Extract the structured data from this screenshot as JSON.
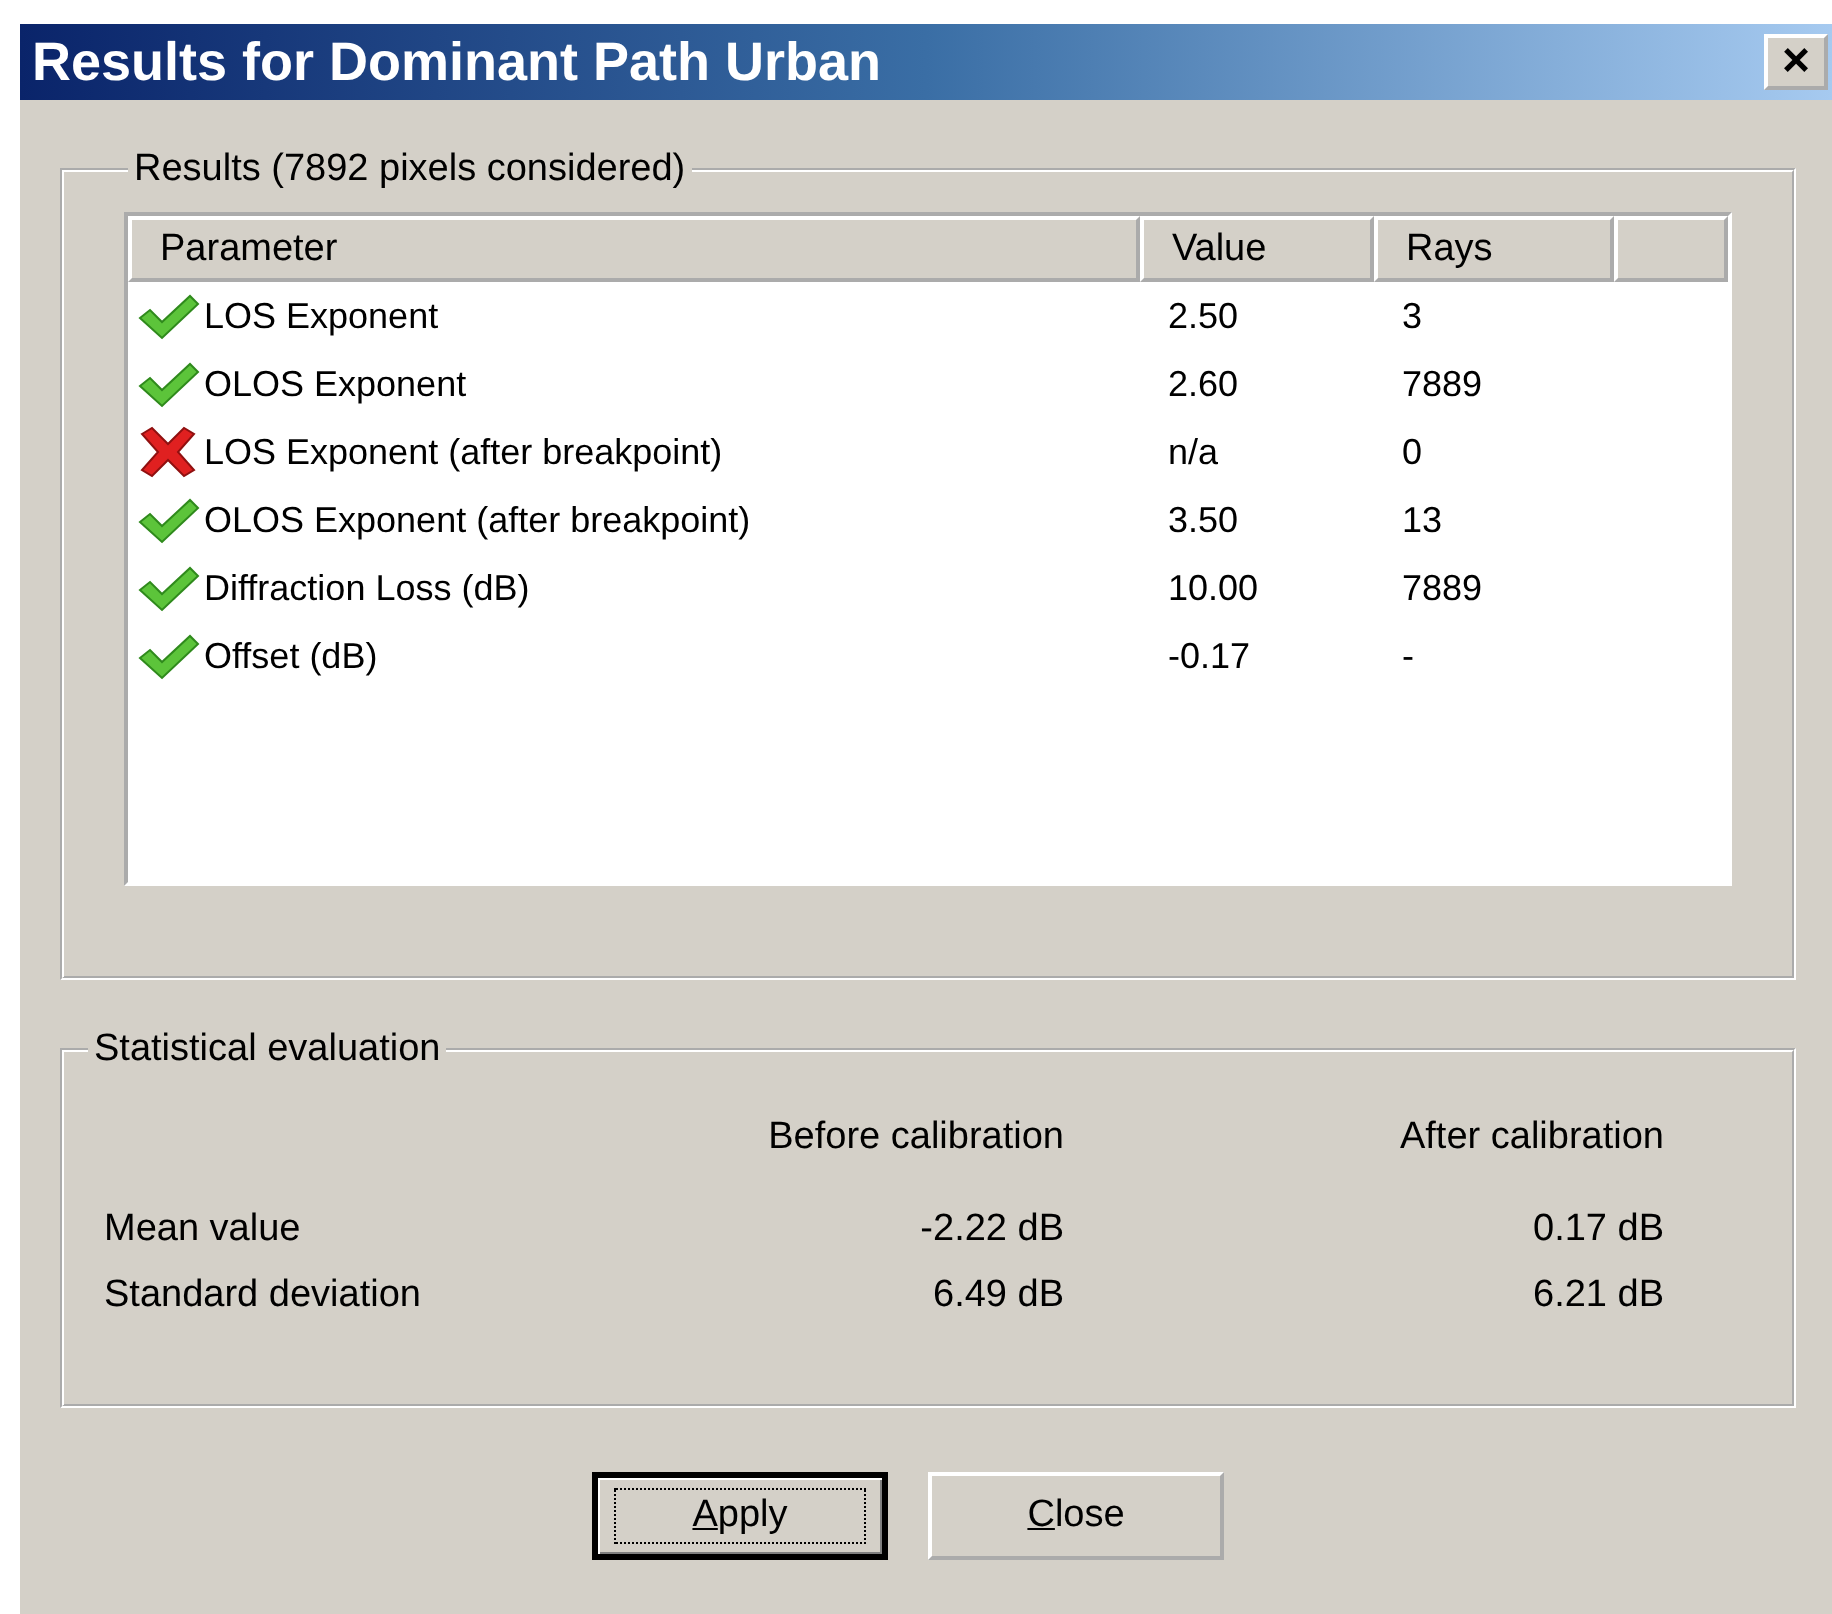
{
  "window": {
    "title": "Results for Dominant Path Urban",
    "close_label": "×"
  },
  "results": {
    "legend": "Results (7892 pixels considered)",
    "columns": [
      "Parameter",
      "Value",
      "Rays"
    ],
    "rows": [
      {
        "parameter": "LOS Exponent",
        "value": "2.50",
        "rays": "3",
        "passed": true
      },
      {
        "parameter": "OLOS Exponent",
        "value": "2.60",
        "rays": "7889",
        "passed": true
      },
      {
        "parameter": "LOS Exponent (after breakpoint)",
        "value": "n/a",
        "rays": "0",
        "passed": false
      },
      {
        "parameter": "OLOS Exponent (after breakpoint)",
        "value": "3.50",
        "rays": "13",
        "passed": true
      },
      {
        "parameter": "Diffraction Loss (dB)",
        "value": "10.00",
        "rays": "7889",
        "passed": true
      },
      {
        "parameter": "Offset (dB)",
        "value": "-0.17",
        "rays": "-",
        "passed": true
      }
    ]
  },
  "statistics": {
    "legend": "Statistical evaluation",
    "columns": [
      "Before calibration",
      "After calibration"
    ],
    "rows": [
      {
        "label": "Mean value",
        "before": "-2.22 dB",
        "after": "0.17 dB"
      },
      {
        "label": "Standard deviation",
        "before": "6.49 dB",
        "after": "6.21 dB"
      }
    ]
  },
  "buttons": [
    {
      "label": "Apply",
      "default": true
    },
    {
      "label": "Close",
      "default": false
    }
  ]
}
